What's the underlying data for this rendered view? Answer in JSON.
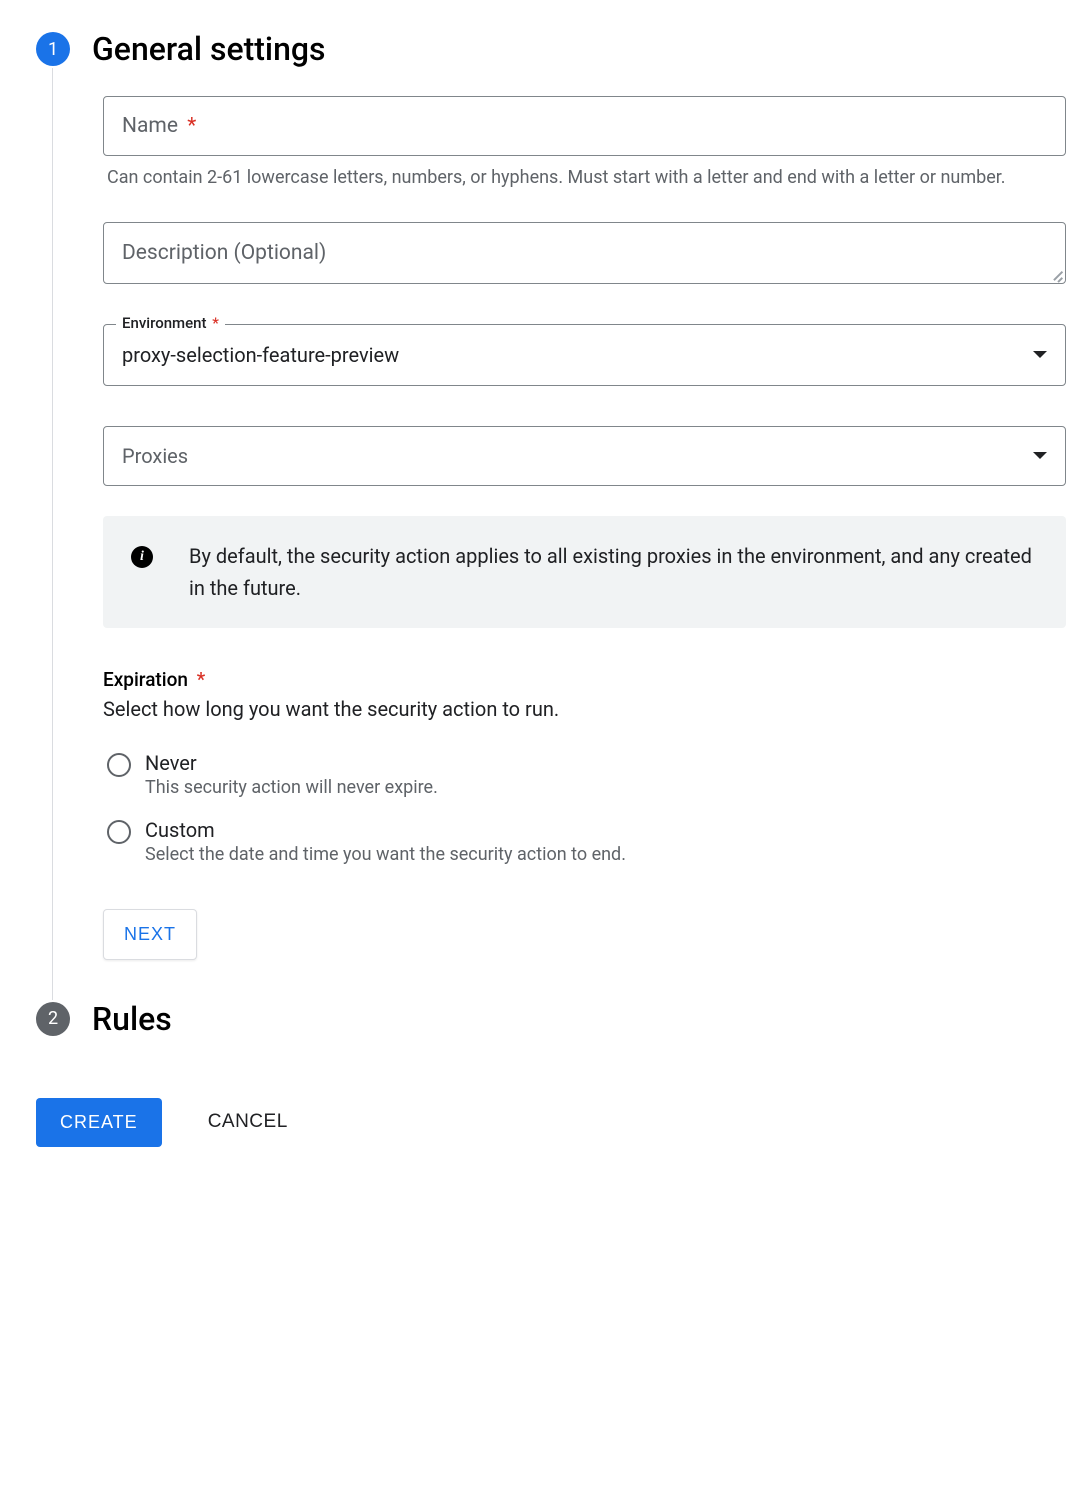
{
  "steps": {
    "step1": {
      "number": "1",
      "title": "General settings"
    },
    "step2": {
      "number": "2",
      "title": "Rules"
    }
  },
  "form": {
    "name": {
      "label": "Name",
      "required": "*",
      "hint": "Can contain 2-61 lowercase letters, numbers, or hyphens. Must start with a letter and end with a letter or number."
    },
    "description": {
      "placeholder": "Description (Optional)"
    },
    "environment": {
      "label": "Environment",
      "required": "*",
      "value": "proxy-selection-feature-preview"
    },
    "proxies": {
      "placeholder": "Proxies"
    },
    "info": {
      "text": "By default, the security action applies to all existing proxies in the environment, and any created in the future."
    },
    "expiration": {
      "label": "Expiration",
      "required": "*",
      "sub": "Select how long you want the security action to run.",
      "options": {
        "never": {
          "title": "Never",
          "desc": "This security action will never expire."
        },
        "custom": {
          "title": "Custom",
          "desc": "Select the date and time you want the security action to end."
        }
      }
    },
    "next_label": "NEXT"
  },
  "footer": {
    "create": "CREATE",
    "cancel": "CANCEL"
  }
}
